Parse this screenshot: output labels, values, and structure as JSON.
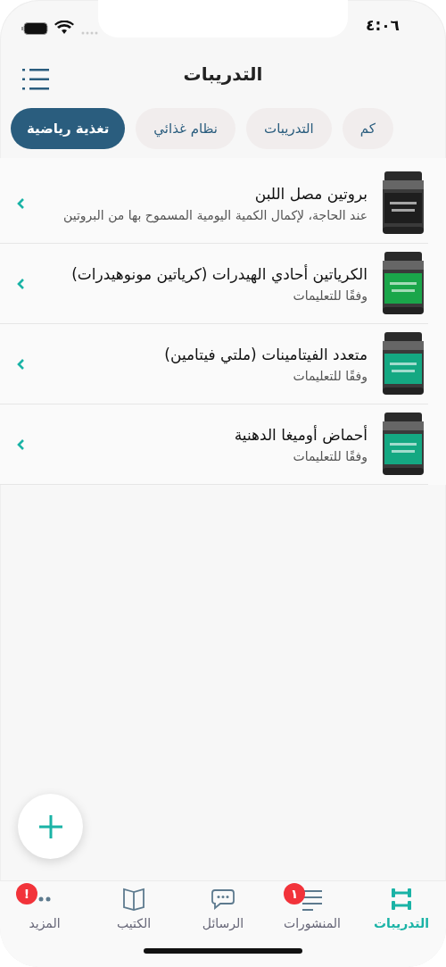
{
  "status_bar": {
    "time": "٤:٠٦"
  },
  "header": {
    "title": "التدريبات"
  },
  "tabs": [
    {
      "label": "كم",
      "selected": false
    },
    {
      "label": "التدريبات",
      "selected": false
    },
    {
      "label": "نظام غذائي",
      "selected": false
    },
    {
      "label": "تغذية رياضية",
      "selected": true
    }
  ],
  "items": [
    {
      "title": "بروتين مصل اللبن",
      "subtitle": "عند الحاجة، لإكمال الكمية اليومية المسموح بها من البروتين",
      "color": "#1e1e1e"
    },
    {
      "title": "الكرياتين أحادي الهيدرات (كرياتين مونوهيدرات)",
      "subtitle": "وفقًا للتعليمات",
      "color": "#1aa64a"
    },
    {
      "title": "متعدد الفيتامينات (ملتي فيتامين)",
      "subtitle": "وفقًا للتعليمات",
      "color": "#14a882"
    },
    {
      "title": "أحماض أوميغا الدهنية",
      "subtitle": "وفقًا للتعليمات",
      "color": "#14a882"
    }
  ],
  "tab_bar": [
    {
      "kind": "dumbbell",
      "label": "التدريبات",
      "selected": true
    },
    {
      "kind": "lines",
      "label": "المنشورات",
      "selected": false,
      "badge": "١"
    },
    {
      "kind": "chat",
      "label": "الرسائل",
      "selected": false
    },
    {
      "kind": "book",
      "label": "الكتيب",
      "selected": false
    },
    {
      "kind": "dots",
      "label": "المزيد",
      "selected": false,
      "badge": "!"
    }
  ]
}
